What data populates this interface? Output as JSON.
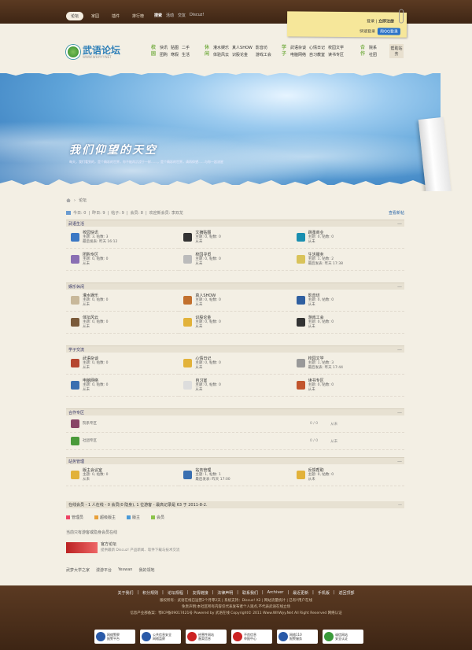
{
  "topnav": {
    "items": [
      "论坛",
      "家园",
      "插件",
      "排行榜"
    ],
    "search_label": "搜索",
    "search_links": [
      "活动",
      "交友",
      "Discuz!"
    ]
  },
  "login": {
    "login": "登录",
    "register": "立即注册",
    "quick": "快速登录",
    "qq": "用QQ登录"
  },
  "logo": {
    "text": "武语论坛",
    "sub": "WWW.WHIYYY.NET"
  },
  "header_cats": [
    {
      "head": "校园",
      "links": [
        "快讯",
        "贴图",
        "二手",
        "团购",
        "寒假",
        "生活"
      ]
    },
    {
      "head": "休闲",
      "links": [
        "灌水娱乐",
        "真人SHOW",
        "影音坊",
        "体验风云",
        "识股论金",
        "游戏工会"
      ]
    },
    {
      "head": "学子",
      "links": [
        "武语杂谈",
        "心情日记",
        "校园文学",
        "电脑网络",
        "自习教室",
        "读书专区"
      ]
    },
    {
      "head": "合作",
      "links": [
        "院系",
        "社团"
      ]
    }
  ],
  "help": "帮助站务",
  "banner": {
    "slogan": "我们仰望的天空",
    "desc": "每天，我们看到的，是个精彩的世界，你不能再沉浸于一样……，是个精彩的世界，请再仰望……与你一起流星"
  },
  "breadcrumb": [
    "论坛"
  ],
  "stats": {
    "today": "今日: 0",
    "yesterday": "昨日: 9",
    "posts": "帖子: 9",
    "members": "会员: 8",
    "welcome": "欢迎新会员: 李双龙",
    "new_posts": "查看新帖"
  },
  "sections": [
    {
      "title": "武语生活",
      "forums": [
        {
          "name": "校园快讯",
          "l1": "主题: 3, 帖数: 3",
          "l2": "最后发表: 昨天 16:12",
          "color": "#3b78c4"
        },
        {
          "name": "文摘贴图",
          "l1": "主题: 0, 帖数: 0",
          "l2": "从未",
          "color": "#333333"
        },
        {
          "name": "跳蚤商业",
          "l1": "主题: 0, 帖数: 0",
          "l2": "从未",
          "color": "#1a8fb0"
        },
        {
          "name": "团购专区",
          "l1": "主题: 0, 帖数: 0",
          "l2": "从未",
          "color": "#8a6fb3"
        },
        {
          "name": "校园寻觅",
          "l1": "主题: 0, 帖数: 0",
          "l2": "从未",
          "color": "#bbbbbb"
        },
        {
          "name": "生活服务",
          "l1": "主题: 1, 帖数: 2",
          "l2": "最后发表: 昨天 17:38",
          "color": "#d9c35a"
        }
      ]
    },
    {
      "title": "娱乐休闲",
      "forums": [
        {
          "name": "灌水娱乐",
          "l1": "主题: 0, 帖数: 0",
          "l2": "从未",
          "color": "#c8b89a"
        },
        {
          "name": "真人SHOW",
          "l1": "主题: 0, 帖数: 0",
          "l2": "从未",
          "color": "#c2702d"
        },
        {
          "name": "影音坊",
          "l1": "主题: 0, 帖数: 0",
          "l2": "从未",
          "color": "#2f5fa0"
        },
        {
          "name": "体坛风云",
          "l1": "主题: 0, 帖数: 0",
          "l2": "从未",
          "color": "#7a5a3a"
        },
        {
          "name": "识股论金",
          "l1": "主题: 0, 帖数: 0",
          "l2": "从未",
          "color": "#e2b23a"
        },
        {
          "name": "游戏工会",
          "l1": "主题: 0, 帖数: 0",
          "l2": "从未",
          "color": "#333333"
        }
      ]
    },
    {
      "title": "学子交流",
      "forums": [
        {
          "name": "武语杂谈",
          "l1": "主题: 0, 帖数: 0",
          "l2": "从未",
          "color": "#b5462f"
        },
        {
          "name": "心情日记",
          "l1": "主题: 0, 帖数: 0",
          "l2": "从未",
          "color": "#e2b23a"
        },
        {
          "name": "校园文学",
          "l1": "主题: 1, 帖数: 3",
          "l2": "最后发表: 昨天 17:44",
          "color": "#999999"
        },
        {
          "name": "电脑网络",
          "l1": "主题: 0, 帖数: 0",
          "l2": "从未",
          "color": "#3a6fb0"
        },
        {
          "name": "自习室",
          "l1": "主题: 0, 帖数: 0",
          "l2": "从未",
          "color": "#dddddd"
        },
        {
          "name": "读书专区",
          "l1": "主题: 0, 帖数: 0",
          "l2": "从未",
          "color": "#c2552d"
        }
      ]
    }
  ],
  "coop": {
    "title": "合作专区",
    "rows": [
      {
        "name": "院系专区",
        "count": "0 / 0",
        "last": "从未",
        "color": "#884466"
      },
      {
        "name": "社团专区",
        "count": "0 / 0",
        "last": "从未",
        "color": "#4a9a3a"
      }
    ]
  },
  "admin": {
    "title": "站务管理",
    "forums": [
      {
        "name": "版主会议室",
        "l1": "主题: 0, 帖数: 0",
        "l2": "从未",
        "color": "#e2b23a"
      },
      {
        "name": "站务管理",
        "l1": "主题: 1, 帖数: 1",
        "l2": "最后发表: 昨天 17:00",
        "color": "#3a6fb0"
      },
      {
        "name": "反馈帮助",
        "l1": "主题: 0, 帖数: 0",
        "l2": "从未",
        "color": "#e2b23a"
      }
    ]
  },
  "online": {
    "text": "在线会员 - 1 人在线 - 0 会员(0 隐身), 1 位游客 - 最高记录是 63 于 2011-8-2.",
    "legend": [
      "管理员",
      "超级版主",
      "版主",
      "会员"
    ],
    "note": "当前只有游客或隐身会员在线"
  },
  "official": {
    "name": "官方论坛",
    "desc": "提供最新 Discuz! 产品新闻、软件下载与技术交流"
  },
  "friendlinks": [
    "武梦大学之家",
    "漫游平台",
    "Yeswan",
    "我的领地"
  ],
  "footer": {
    "nav": [
      "关于我们",
      "积分规则",
      "论坛规程",
      "友情链接",
      "法律声明",
      "联系我们",
      "Archiver",
      "最近更新",
      "手机版",
      "返回顶部"
    ],
    "line1": "版权所有：武语在线已运营2个月零2天 | 系统支持：Discuz! X2 | 网站流量统计 | 已有Y用户在线",
    "line2": "免责声明:本社区所有内容仅代表发布者个人观点,不代表武语在线立场",
    "line3": "信息产业部备案：鄂ICP备09017421号 Powered by 武语在线 Copyright© 2011 Www.WhWyy.Net All Right Reserved 网络认证",
    "seals": [
      {
        "label": "网络警察\n报警平台",
        "color": "#2a5aa8"
      },
      {
        "label": "公共信息安全\n网络监察",
        "color": "#2a5aa8"
      },
      {
        "label": "经营性网站\n备案信息",
        "color": "#c22"
      },
      {
        "label": "不良信息\n举报中心",
        "color": "#c22"
      },
      {
        "label": "网络110\n报警服务",
        "color": "#2a5aa8"
      },
      {
        "label": "诚信网站\n安全认证",
        "color": "#3a9a3a"
      }
    ]
  }
}
